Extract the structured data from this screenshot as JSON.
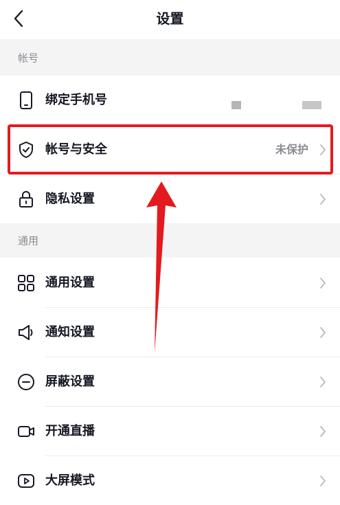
{
  "header": {
    "title": "设置"
  },
  "sections": {
    "account": "帐号",
    "general": "通用"
  },
  "rows": [
    {
      "label": "绑定手机号",
      "value": "",
      "icon": "phone-icon"
    },
    {
      "label": "帐号与安全",
      "value": "未保护",
      "icon": "shield-check-icon"
    },
    {
      "label": "隐私设置",
      "value": "",
      "icon": "lock-icon"
    },
    {
      "label": "通用设置",
      "value": "",
      "icon": "grid-icon"
    },
    {
      "label": "通知设置",
      "value": "",
      "icon": "speaker-icon"
    },
    {
      "label": "屏蔽设置",
      "value": "",
      "icon": "minus-circle-icon"
    },
    {
      "label": "开通直播",
      "value": "",
      "icon": "video-camera-icon"
    },
    {
      "label": "大屏模式",
      "value": "",
      "icon": "play-screen-icon"
    }
  ],
  "colors": {
    "highlight": "#e31b1e",
    "section_bg": "#f4f4f5",
    "secondary_text": "#8a8b91"
  }
}
